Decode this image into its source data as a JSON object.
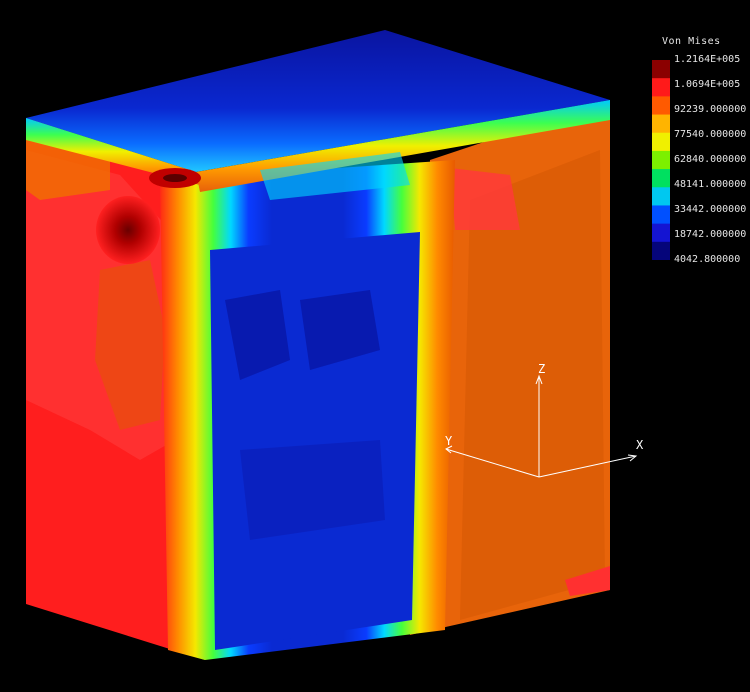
{
  "legend": {
    "title": "Von Mises",
    "labels": [
      "1.2164E+005",
      "1.0694E+005",
      "92239.000000",
      "77540.000000",
      "62840.000000",
      "48141.000000",
      "33442.000000",
      "18742.000000",
      "4042.800000"
    ],
    "colors": [
      "#8b0000",
      "#ff1a1a",
      "#ff5a00",
      "#ffb400",
      "#f0f000",
      "#7cf000",
      "#00e060",
      "#00c8f0",
      "#0050ff",
      "#1414d2",
      "#05057a"
    ]
  },
  "axes": {
    "x_label": "X",
    "y_label": "Y",
    "z_label": "Z"
  },
  "palette": {
    "background": "#000000",
    "low": "#0a14c8",
    "deep_low": "#050a8c",
    "high": "#ff1414",
    "high_mid": "#e06000"
  }
}
